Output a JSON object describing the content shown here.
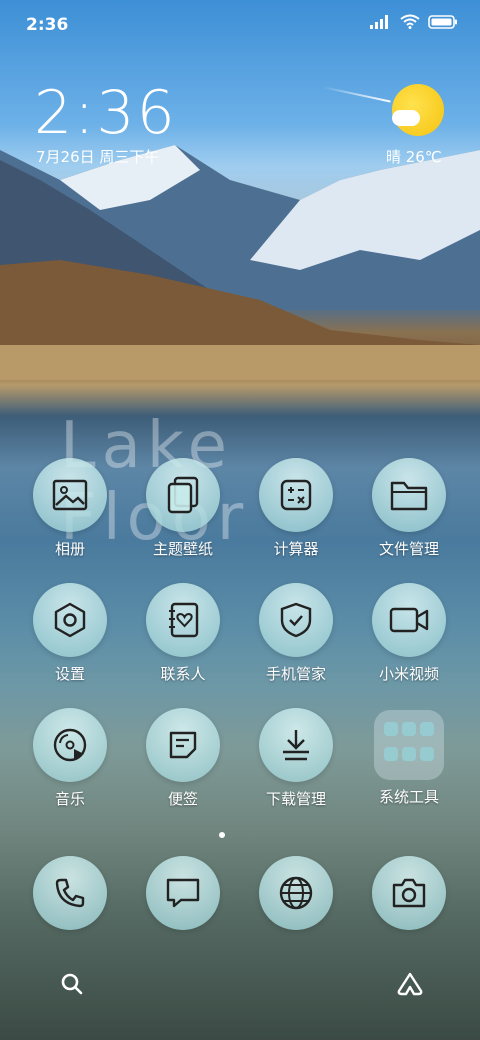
{
  "status_bar": {
    "time": "2:36"
  },
  "lockscreen": {
    "clock": "2:36",
    "date": "7月26日 周三下午",
    "weather": "晴 26℃"
  },
  "watermark": {
    "line1": "Lake",
    "line2": "Floor"
  },
  "apps": [
    {
      "label": "相册",
      "icon": "gallery-icon"
    },
    {
      "label": "主题壁纸",
      "icon": "themes-icon"
    },
    {
      "label": "计算器",
      "icon": "calculator-icon"
    },
    {
      "label": "文件管理",
      "icon": "folder-icon"
    },
    {
      "label": "设置",
      "icon": "settings-icon"
    },
    {
      "label": "联系人",
      "icon": "contacts-icon"
    },
    {
      "label": "手机管家",
      "icon": "security-icon"
    },
    {
      "label": "小米视频",
      "icon": "video-icon"
    },
    {
      "label": "音乐",
      "icon": "music-icon"
    },
    {
      "label": "便签",
      "icon": "notes-icon"
    },
    {
      "label": "下载管理",
      "icon": "download-icon"
    },
    {
      "label": "系统工具",
      "icon": "folder-group-icon"
    }
  ],
  "dock": [
    {
      "icon": "phone-icon"
    },
    {
      "icon": "message-icon"
    },
    {
      "icon": "browser-icon"
    },
    {
      "icon": "camera-icon"
    }
  ],
  "bottom_bar": {
    "left_icon": "search-icon",
    "right_icon": "assistant-icon"
  },
  "colors": {
    "icon_bg": "#a8d8da",
    "sun": "#f5c310"
  }
}
